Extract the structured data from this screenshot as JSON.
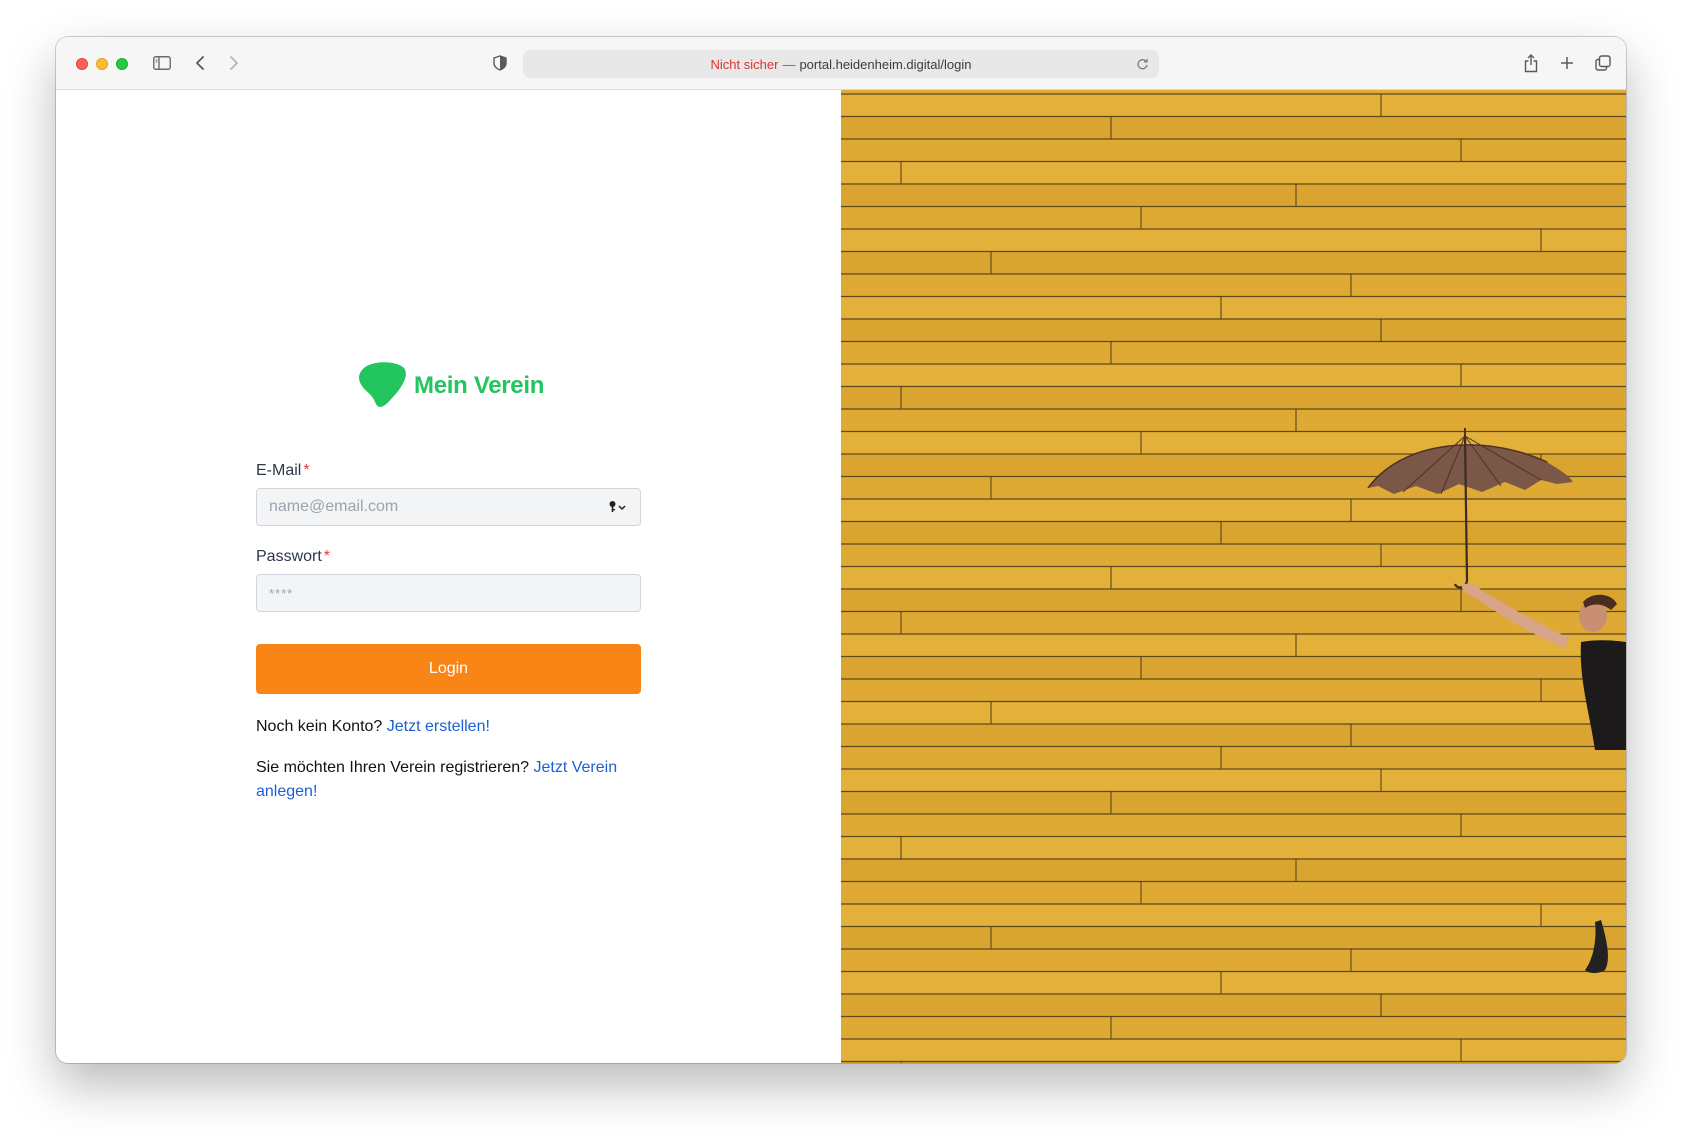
{
  "browser": {
    "url_warning": "Nicht sicher",
    "url_separator": "—",
    "url": "portal.heidenheim.digital/login",
    "icons": [
      "sidebar-icon",
      "back-icon",
      "forward-icon",
      "privacy-shield-icon",
      "reload-icon",
      "share-icon",
      "new-tab-icon",
      "tab-overview-icon"
    ]
  },
  "brand": {
    "name": "Mein Verein",
    "color": "#22c55e"
  },
  "form": {
    "email_label": "E-Mail",
    "email_placeholder": "name@email.com",
    "password_label": "Passwort",
    "password_placeholder": "****",
    "required_marker": "*",
    "login_label": "Login",
    "button_color": "#f98516"
  },
  "signup": {
    "prompt": "Noch kein Konto?",
    "link": "Jetzt erstellen!"
  },
  "register": {
    "prompt": "Sie möchten Ihren Verein registrieren?",
    "link": "Jetzt Verein anlegen!"
  },
  "hero_image": {
    "description_icon": "woman-with-umbrella-on-yellow-wall-image",
    "background_color": "#dfa92f"
  }
}
